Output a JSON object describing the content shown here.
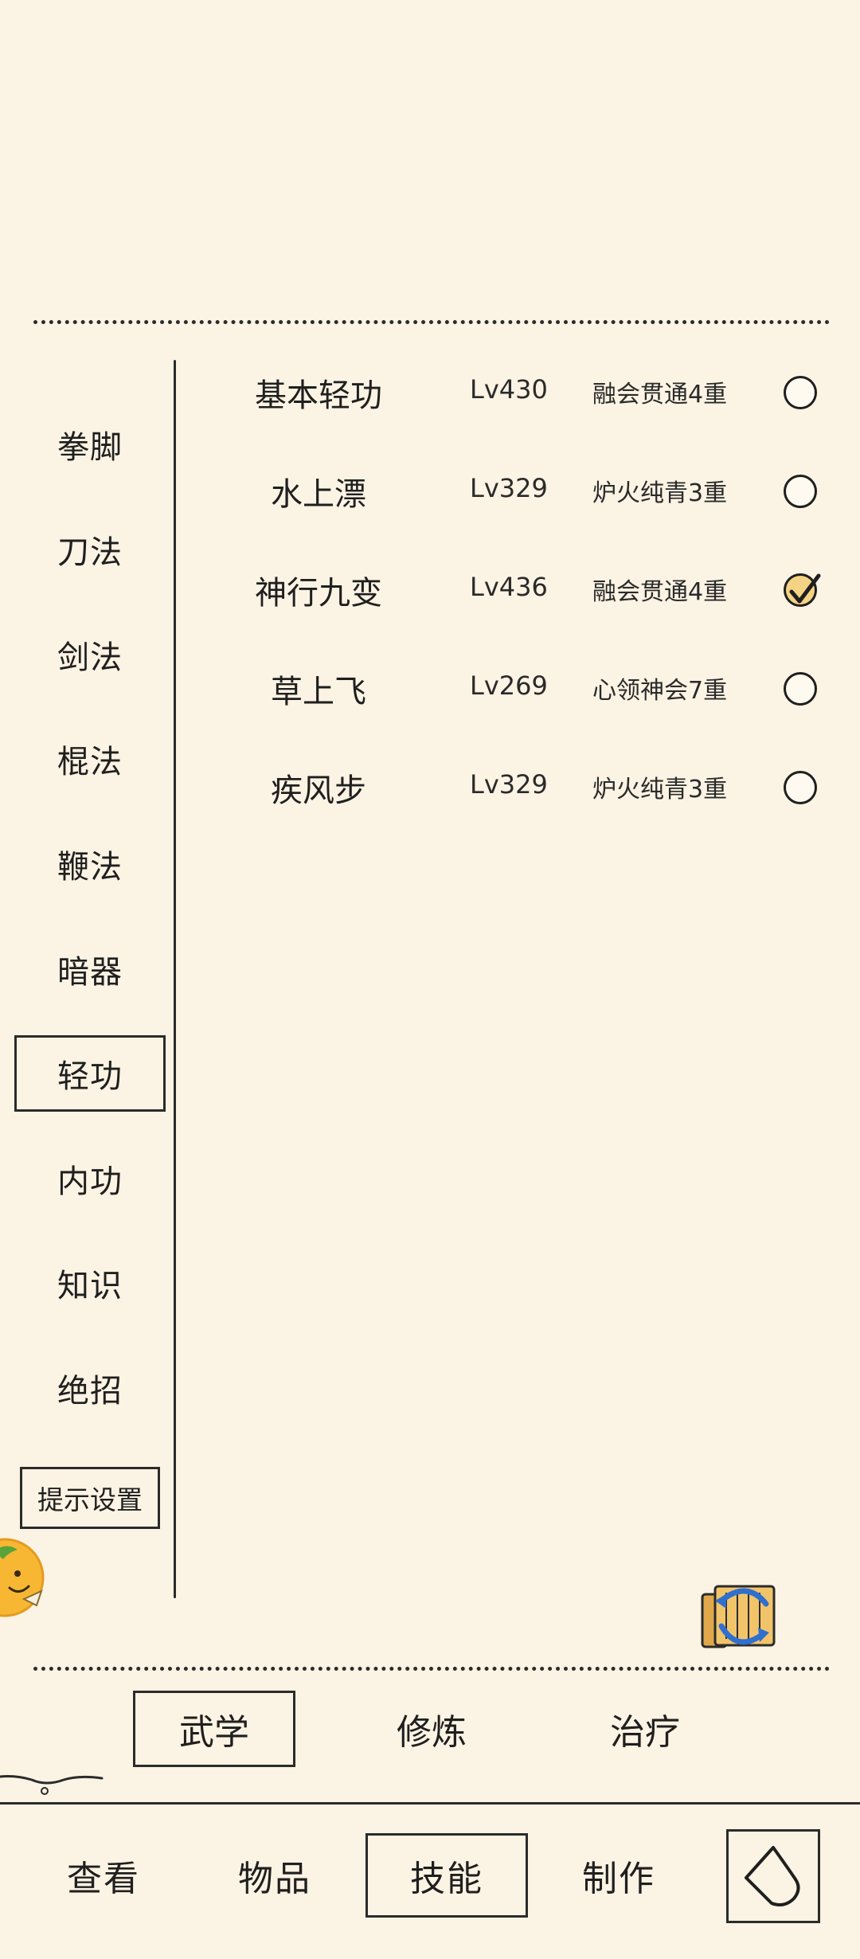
{
  "categories": [
    {
      "label": "拳脚",
      "active": false
    },
    {
      "label": "刀法",
      "active": false
    },
    {
      "label": "剑法",
      "active": false
    },
    {
      "label": "棍法",
      "active": false
    },
    {
      "label": "鞭法",
      "active": false
    },
    {
      "label": "暗器",
      "active": false
    },
    {
      "label": "轻功",
      "active": true
    },
    {
      "label": "内功",
      "active": false
    },
    {
      "label": "知识",
      "active": false
    },
    {
      "label": "绝招",
      "active": false
    }
  ],
  "settings_label": "提示设置",
  "skills": [
    {
      "name": "基本轻功",
      "level": "Lv430",
      "stage": "融会贯通4重",
      "selected": false
    },
    {
      "name": "水上漂",
      "level": "Lv329",
      "stage": "炉火纯青3重",
      "selected": false
    },
    {
      "name": "神行九变",
      "level": "Lv436",
      "stage": "融会贯通4重",
      "selected": true
    },
    {
      "name": "草上飞",
      "level": "Lv269",
      "stage": "心领神会7重",
      "selected": false
    },
    {
      "name": "疾风步",
      "level": "Lv329",
      "stage": "炉火纯青3重",
      "selected": false
    }
  ],
  "subtabs": [
    {
      "label": "武学",
      "active": true
    },
    {
      "label": "修炼",
      "active": false
    },
    {
      "label": "治疗",
      "active": false
    }
  ],
  "nav": [
    {
      "label": "查看",
      "active": false
    },
    {
      "label": "物品",
      "active": false
    },
    {
      "label": "技能",
      "active": true
    },
    {
      "label": "制作",
      "active": false
    }
  ],
  "icons": {
    "radio_checked": "checkmark-icon",
    "scroll": "scroll-swap-icon",
    "back": "back-arrow-icon",
    "mascot": "orange-mascot-icon"
  },
  "colors": {
    "background": "#fbf3e3",
    "ink": "#2b2b2b",
    "check_fill": "#f4d385"
  }
}
